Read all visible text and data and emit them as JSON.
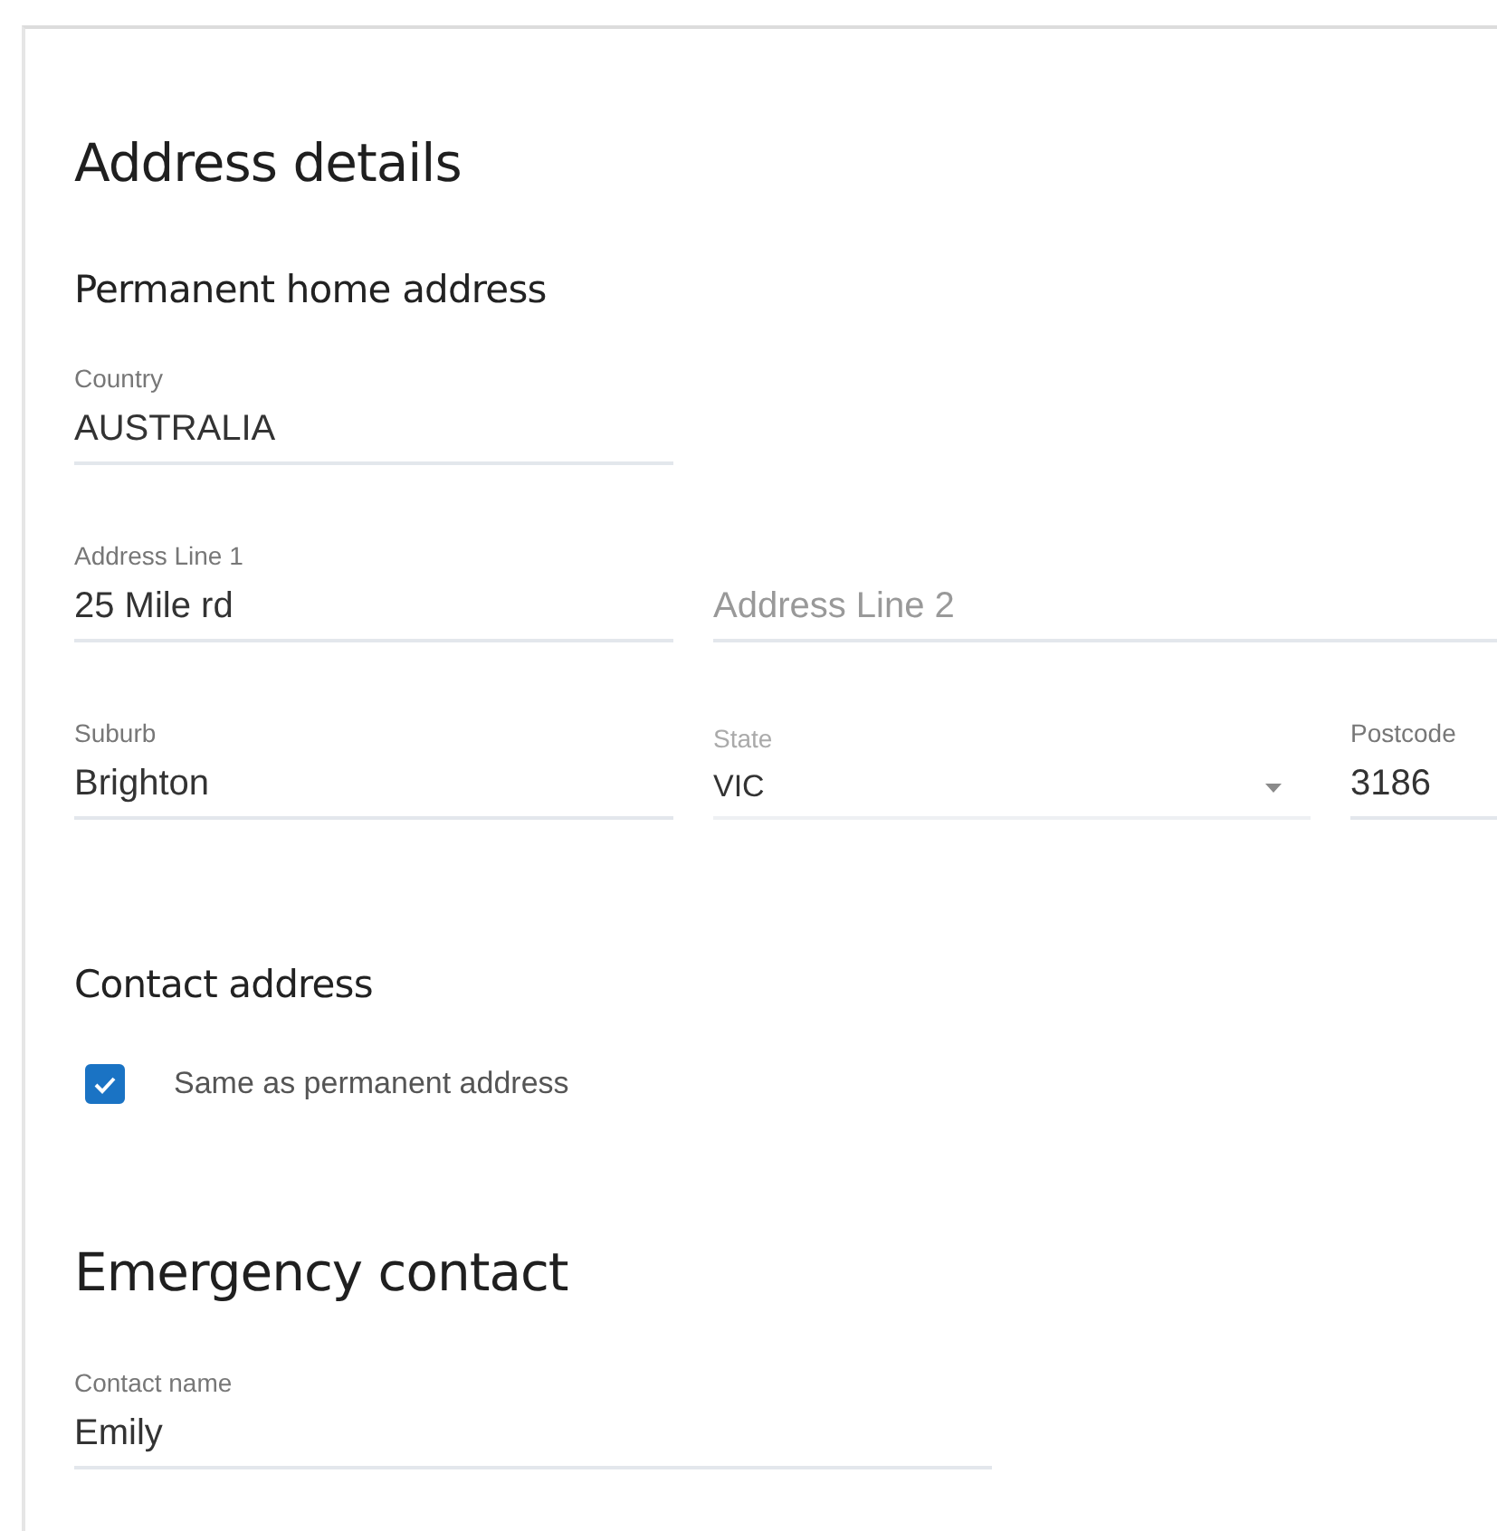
{
  "sections": [
    {
      "title": "Address details",
      "subsections": [
        {
          "title": "Permanent home address",
          "rows": [
            [
              {
                "kind": "text",
                "label": "Country",
                "value": "AUSTRALIA"
              }
            ],
            [
              {
                "kind": "text",
                "label": "Address Line 1",
                "value": "25 Mile rd"
              },
              {
                "kind": "placeholder",
                "placeholder": "Address Line 2"
              }
            ],
            [
              {
                "kind": "text",
                "label": "Suburb",
                "value": "Brighton"
              },
              {
                "kind": "select",
                "label": "State",
                "value": "VIC"
              },
              {
                "kind": "text",
                "label": "Postcode",
                "value": "3186"
              }
            ]
          ]
        },
        {
          "title": "Contact address",
          "checkbox": {
            "label": "Same as permanent address",
            "checked": true
          }
        }
      ]
    },
    {
      "title": "Emergency contact",
      "subsections": [
        {
          "rows": [
            [
              {
                "kind": "wide",
                "label": "Contact name",
                "value": "Emily"
              }
            ]
          ]
        }
      ]
    }
  ]
}
